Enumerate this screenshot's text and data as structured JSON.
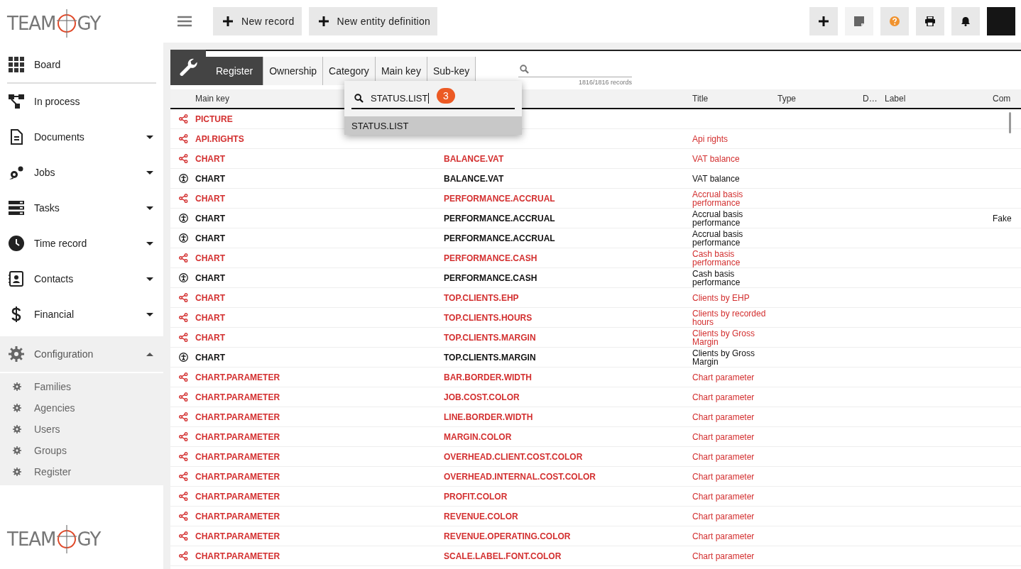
{
  "logo": {
    "before": "TEAM",
    "after": "GY"
  },
  "sidebar": {
    "items": [
      {
        "label": "Board"
      },
      {
        "label": "In process"
      },
      {
        "label": "Documents",
        "expanded": false
      },
      {
        "label": "Jobs",
        "expanded": false
      },
      {
        "label": "Tasks",
        "expanded": false
      },
      {
        "label": "Time record",
        "expanded": false
      },
      {
        "label": "Contacts",
        "expanded": false
      },
      {
        "label": "Financial",
        "expanded": false
      },
      {
        "label": "Configuration",
        "expanded": true,
        "children": [
          {
            "label": "Families"
          },
          {
            "label": "Agencies"
          },
          {
            "label": "Users"
          },
          {
            "label": "Groups"
          },
          {
            "label": "Register"
          }
        ]
      }
    ]
  },
  "footer_logo": {
    "before": "TEAM",
    "after": "GY"
  },
  "toolbar": {
    "buttons": [
      "New record",
      "New entity definition"
    ]
  },
  "breadcrumb": [
    {
      "label": "Register",
      "selected": true
    },
    {
      "label": "Ownership",
      "selected": false
    },
    {
      "label": "Category",
      "selected": false
    },
    {
      "label": "Main key",
      "selected": false
    },
    {
      "label": "Sub-key",
      "selected": false
    }
  ],
  "search": {
    "count": "1816/1816 records"
  },
  "popup": {
    "value": "STATUS.LIST",
    "badge": "3",
    "options": [
      {
        "label": "STATUS.LIST",
        "selected": true
      }
    ]
  },
  "table": {
    "columns": {
      "main_key": "Main key",
      "title": "Title",
      "type": "Type",
      "column_5": "D…",
      "label": "Label",
      "column_7": "Com"
    },
    "rows": [
      {
        "kind": "shared",
        "main_key": "PICTURE"
      },
      {
        "kind": "shared",
        "main_key": "API.RIGHTS",
        "title": "Api rights"
      },
      {
        "kind": "shared",
        "main_key": "CHART",
        "sub_key": "BALANCE.VAT",
        "title": "VAT balance"
      },
      {
        "kind": "system",
        "main_key": "CHART",
        "sub_key": "BALANCE.VAT",
        "title": "VAT balance"
      },
      {
        "kind": "shared",
        "main_key": "CHART",
        "sub_key": "PERFORMANCE.ACCRUAL",
        "title": "Accrual basis performance"
      },
      {
        "kind": "system",
        "main_key": "CHART",
        "sub_key": "PERFORMANCE.ACCRUAL",
        "title": "Accrual basis performance",
        "comment": "Fake"
      },
      {
        "kind": "system",
        "main_key": "CHART",
        "sub_key": "PERFORMANCE.ACCRUAL",
        "title": "Accrual basis performance"
      },
      {
        "kind": "shared",
        "main_key": "CHART",
        "sub_key": "PERFORMANCE.CASH",
        "title": "Cash basis performance"
      },
      {
        "kind": "system",
        "main_key": "CHART",
        "sub_key": "PERFORMANCE.CASH",
        "title": "Cash basis performance"
      },
      {
        "kind": "shared",
        "main_key": "CHART",
        "sub_key": "TOP.CLIENTS.EHP",
        "title": "Clients by EHP"
      },
      {
        "kind": "shared",
        "main_key": "CHART",
        "sub_key": "TOP.CLIENTS.HOURS",
        "title": "Clients by recorded hours"
      },
      {
        "kind": "shared",
        "main_key": "CHART",
        "sub_key": "TOP.CLIENTS.MARGIN",
        "title": "Clients by Gross Margin"
      },
      {
        "kind": "system",
        "main_key": "CHART",
        "sub_key": "TOP.CLIENTS.MARGIN",
        "title": "Clients by Gross Margin"
      },
      {
        "kind": "shared",
        "main_key": "CHART.PARAMETER",
        "sub_key": "BAR.BORDER.WIDTH",
        "title": "Chart parameter"
      },
      {
        "kind": "shared",
        "main_key": "CHART.PARAMETER",
        "sub_key": "JOB.COST.COLOR",
        "title": "Chart parameter"
      },
      {
        "kind": "shared",
        "main_key": "CHART.PARAMETER",
        "sub_key": "LINE.BORDER.WIDTH",
        "title": "Chart parameter"
      },
      {
        "kind": "shared",
        "main_key": "CHART.PARAMETER",
        "sub_key": "MARGIN.COLOR",
        "title": "Chart parameter"
      },
      {
        "kind": "shared",
        "main_key": "CHART.PARAMETER",
        "sub_key": "OVERHEAD.CLIENT.COST.COLOR",
        "title": "Chart parameter"
      },
      {
        "kind": "shared",
        "main_key": "CHART.PARAMETER",
        "sub_key": "OVERHEAD.INTERNAL.COST.COLOR",
        "title": "Chart parameter"
      },
      {
        "kind": "shared",
        "main_key": "CHART.PARAMETER",
        "sub_key": "PROFIT.COLOR",
        "title": "Chart parameter"
      },
      {
        "kind": "shared",
        "main_key": "CHART.PARAMETER",
        "sub_key": "REVENUE.COLOR",
        "title": "Chart parameter"
      },
      {
        "kind": "shared",
        "main_key": "CHART.PARAMETER",
        "sub_key": "REVENUE.OPERATING.COLOR",
        "title": "Chart parameter"
      },
      {
        "kind": "shared",
        "main_key": "CHART.PARAMETER",
        "sub_key": "SCALE.LABEL.FONT.COLOR",
        "title": "Chart parameter"
      }
    ]
  }
}
